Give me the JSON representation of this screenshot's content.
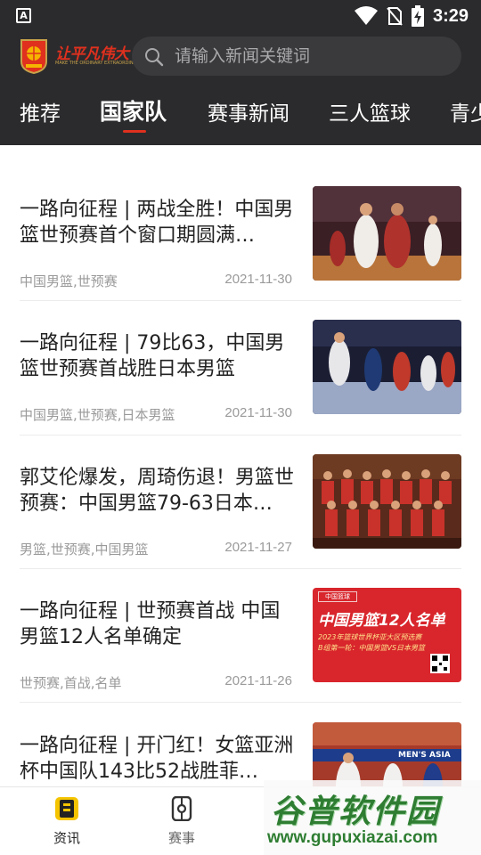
{
  "status_bar": {
    "time": "3:29",
    "left_icon": "A"
  },
  "header": {
    "logo_text": "让平凡伟大",
    "logo_sub": "MAKE THE ORDINARY EXTRAORDINARY",
    "search_placeholder": "请输入新闻关键词"
  },
  "tabs": [
    {
      "label": "推荐"
    },
    {
      "label": "国家队"
    },
    {
      "label": "赛事新闻"
    },
    {
      "label": "三人篮球"
    },
    {
      "label": "青少"
    }
  ],
  "active_tab": "国家队",
  "articles": [
    {
      "title": "一路向征程 | 两战全胜！中国男篮世预赛首个窗口期圆满…",
      "tags": "中国男篮,世预赛",
      "date": "2021-11-30"
    },
    {
      "title": "一路向征程 | 79比63，中国男篮世预赛首战胜日本男篮",
      "tags": "中国男篮,世预赛,日本男篮",
      "date": "2021-11-30"
    },
    {
      "title": "郭艾伦爆发，周琦伤退！男篮世预赛：中国男篮79-63日本…",
      "tags": "男篮,世预赛,中国男篮",
      "date": "2021-11-27"
    },
    {
      "title": "一路向征程 | 世预赛首战 中国男篮12人名单确定",
      "tags": "世预赛,首战,名单",
      "date": "2021-11-26"
    },
    {
      "title": "一路向征程 | 开门红！女篮亚洲杯中国队143比52战胜菲…",
      "tags": "",
      "date": ""
    }
  ],
  "thumb_texts": {
    "a4_badge": "中国篮球",
    "a4_title": "中国男篮12人名单",
    "a4_sub1": "2023年篮球世界杯亚大区预选赛",
    "a4_sub2": "B组第一轮：中国男篮VS日本男篮",
    "a5_banner": "MEN'S ASIA"
  },
  "bottom_nav": [
    {
      "label": "资讯",
      "icon": "news-icon",
      "active": true
    },
    {
      "label": "赛事",
      "icon": "match-icon",
      "active": false
    }
  ],
  "watermark": {
    "cn": "谷普软件园",
    "url": "www.gupuxiazai.com"
  },
  "colors": {
    "header_bg": "#2b2b2d",
    "accent": "#e0301e",
    "active_nav": "#222222",
    "inactive_nav": "#666666"
  }
}
